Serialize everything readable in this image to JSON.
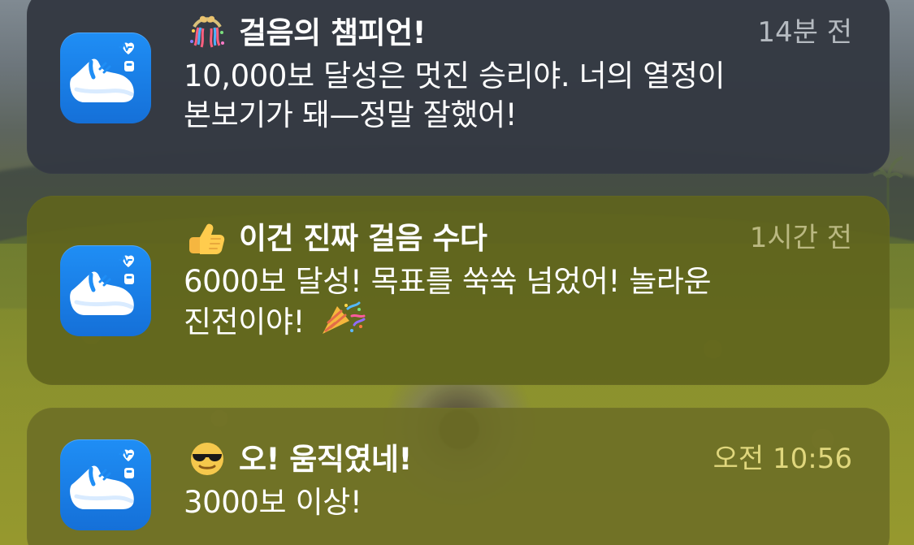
{
  "notifications": [
    {
      "title": "걸음의 챔피언!",
      "time": "14분 전",
      "body_lines": [
        "10,000보 달성은 멋진 승리야. 너의 열정이",
        "본보기가 돼—정말 잘했어!"
      ],
      "title_icon": "confetti-ball-icon",
      "app_icon": "pedometer-shoe-icon"
    },
    {
      "title": "이건 진짜 걸음 수다",
      "time": "1시간 전",
      "body_lines": [
        "6000보 달성! 목표를 쑥쑥 넘었어! 놀라운",
        "진전이야!"
      ],
      "title_icon": "thumbs-up-icon",
      "body_icon": "party-popper-icon",
      "app_icon": "pedometer-shoe-icon"
    },
    {
      "title": "오! 움직였네!",
      "time": "오전 10:56",
      "body_lines": [
        "3000보 이상!"
      ],
      "title_icon": "sunglasses-face-icon",
      "app_icon": "pedometer-shoe-icon"
    }
  ],
  "colors": {
    "notification_dark": "#343942",
    "notification_olive": "#60641d",
    "app_icon_blue": "#1f8ef5",
    "text_primary": "#ffffff"
  }
}
